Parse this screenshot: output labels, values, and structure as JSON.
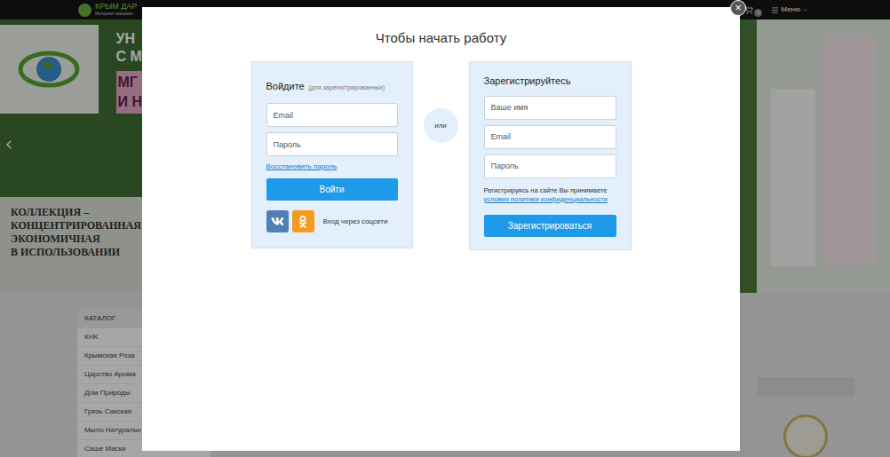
{
  "site_header": {
    "logo_name": "КРЫМ ДАР",
    "logo_tagline": "Интернет-магазин",
    "cart_count": "0",
    "menu": "Меню"
  },
  "banner": {
    "headline_top": [
      "УН",
      "С М"
    ],
    "headline_box": [
      "МГ",
      "И Н"
    ],
    "subline": [
      "КОЛЛЕКЦИЯ –",
      "КОНЦЕНТРИРОВАННАЯ",
      "ЭКОНОМИЧНАЯ",
      "В ИСПОЛЬЗОВАНИИ"
    ]
  },
  "catalog": {
    "title": "КАТАЛОГ",
    "items": [
      "КНК",
      "Крымская Роза",
      "Царство Арома",
      "Дом Природы",
      "Грязь Сакская",
      "Мыло Натуральн",
      "Саше Маски"
    ]
  },
  "modal": {
    "title": "Чтобы начать работу",
    "close": "×",
    "separator": "или",
    "login": {
      "title": "Войдите",
      "hint": "(для зарегистрированных)",
      "fields": [
        {
          "placeholder": "Email"
        },
        {
          "placeholder": "Пароль"
        }
      ],
      "restore_link": "Восстановить пароль",
      "button": "Войти",
      "social": {
        "label": "Вход через соцсети",
        "networks": [
          {
            "kind": "vk",
            "color": "#4f7fb5"
          },
          {
            "kind": "ok",
            "color": "#f49a1e"
          }
        ]
      }
    },
    "register": {
      "title": "Зарегистрируйтесь",
      "fields": [
        {
          "placeholder": "Ваше имя"
        },
        {
          "placeholder": "Email"
        },
        {
          "placeholder": "Пароль"
        }
      ],
      "terms": "Регистрируясь на сайте Вы принимаете",
      "terms_link": "условия политики конфиденциальности",
      "button": "Зарегистрироваться"
    }
  }
}
